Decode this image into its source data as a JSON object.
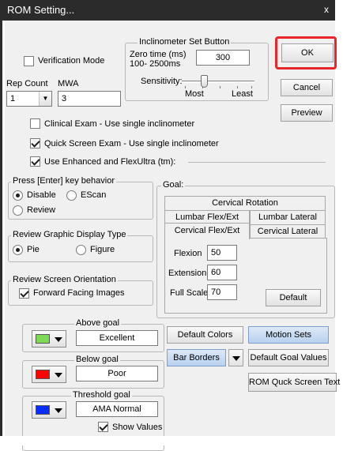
{
  "window": {
    "title": "ROM Setting...",
    "close_glyph": "x"
  },
  "verification": {
    "label": "Verification Mode",
    "checked": false
  },
  "inclinometer": {
    "group_title": "Inclinometer Set Button",
    "zero_time_label_line1": "Zero time (ms)",
    "zero_time_label_line2": "100- 2500ms",
    "zero_time_value": "300",
    "sensitivity_label": "Sensitivity:",
    "sensitivity_most": "Most",
    "sensitivity_least": "Least",
    "sensitivity_level": 0.3
  },
  "rep": {
    "rep_count_label": "Rep Count",
    "rep_count_value": "1",
    "mwa_label": "MWA",
    "mwa_value": "3"
  },
  "buttons": {
    "ok": "OK",
    "cancel": "Cancel",
    "preview": "Preview"
  },
  "options": {
    "clinical": "Clinical Exam - Use single inclinometer",
    "quick_screen": "Quick Screen Exam - Use single inclinometer",
    "enhanced": "Use Enhanced and FlexUltra (tm):",
    "clinical_checked": false,
    "quick_screen_checked": true,
    "enhanced_checked": true
  },
  "enter_key": {
    "title": "Press [Enter] key behavior",
    "disable": "Disable",
    "escan": "EScan",
    "review": "Review",
    "selected": "Disable"
  },
  "review_graphic": {
    "title": "Review Graphic Display Type",
    "pie": "Pie",
    "figure": "Figure",
    "selected": "Pie"
  },
  "review_orientation": {
    "title": "Review Screen Orientation",
    "forward": "Forward Facing Images",
    "forward_checked": true
  },
  "goal": {
    "title": "Goal:",
    "tabs_row1": [
      "Cervical Rotation"
    ],
    "tabs_row2": [
      "Lumbar Flex/Ext",
      "Lumbar Lateral"
    ],
    "tabs_row3": [
      "Cervical Flex/Ext",
      "Cervical Lateral"
    ],
    "active_tab": "Cervical Flex/Ext",
    "flexion_label": "Flexion",
    "flexion_value": "50",
    "extension_label": "Extension",
    "extension_value": "60",
    "fullscale_label": "Full Scale",
    "fullscale_value": "70",
    "default_button": "Default"
  },
  "above_goal": {
    "title": "Above goal",
    "value": "Excellent",
    "color": "#7ed957"
  },
  "below_goal": {
    "title": "Below goal",
    "value": "Poor",
    "color": "#ff0000"
  },
  "threshold_goal": {
    "title": "Threshold goal",
    "value": "AMA Normal",
    "color": "#0a2dff",
    "show_values_label": "Show Values",
    "show_values_checked": true
  },
  "right_buttons": {
    "default_colors": "Default Colors",
    "motion_sets": "Motion Sets",
    "bar_borders": "Bar Borders",
    "default_goal_values": "Default Goal Values",
    "rom_quick_screen_text": "ROM Quck Screen Text"
  },
  "colors": {
    "ok_highlight": "#e8262b",
    "titlebar": "#2b2b2b"
  }
}
